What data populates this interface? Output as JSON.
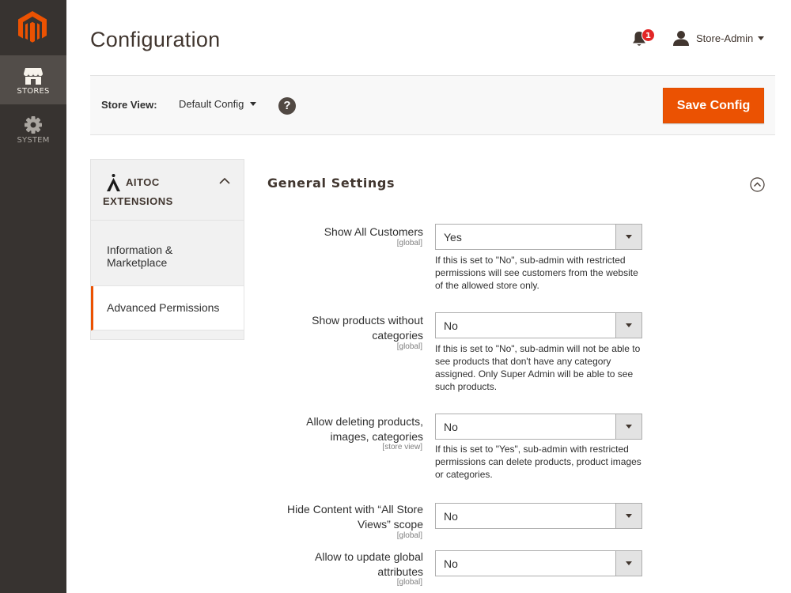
{
  "nav": {
    "items": [
      {
        "label": "STORES",
        "icon": "store-icon"
      },
      {
        "label": "SYSTEM",
        "icon": "gear-icon"
      }
    ]
  },
  "header": {
    "title": "Configuration",
    "notifications_count": "1",
    "user_name": "Store-Admin"
  },
  "store_bar": {
    "label": "Store View:",
    "selected": "Default Config",
    "help": "?",
    "save_label": "Save Config"
  },
  "config_tabs": {
    "group_line1": "AITOC",
    "group_line2": "EXTENSIONS",
    "items": [
      {
        "label": "Information & Marketplace",
        "active": false
      },
      {
        "label": "Advanced Permissions",
        "active": true
      }
    ]
  },
  "section": {
    "title": "General Settings",
    "fields": [
      {
        "label": "Show All Customers",
        "scope": "[global]",
        "value": "Yes",
        "note": "If this is set to \"No\", sub-admin with restricted permissions will see customers from the website of the allowed store only."
      },
      {
        "label_line1": "Show products without",
        "label_line2": "categories",
        "scope": "[global]",
        "value": "No",
        "note": "If this is set to \"No\", sub-admin will not be able to see products that don't have any category assigned. Only Super Admin will be able to see such products."
      },
      {
        "label_line1": "Allow deleting products,",
        "label_line2": "images, categories",
        "scope": "[store view]",
        "value": "No",
        "note": "If this is set to \"Yes\", sub-admin with restricted permissions can delete products, product images or categories."
      },
      {
        "label_line1": "Hide Content with “All Store",
        "label_line2": "Views” scope",
        "scope": "[global]",
        "value": "No"
      },
      {
        "label_line1": "Allow to update global",
        "label_line2": "attributes",
        "scope": "[global]",
        "value": "No"
      }
    ]
  },
  "colors": {
    "nav_bg": "#373330",
    "nav_active": "#524d49",
    "accent": "#eb5202",
    "badge": "#e22626"
  }
}
